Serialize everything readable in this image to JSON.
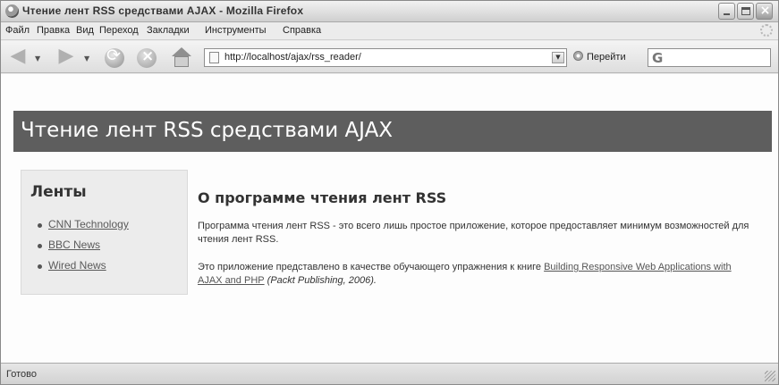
{
  "window": {
    "title": "Чтение лент RSS средствами AJAX - Mozilla Firefox"
  },
  "menu": {
    "items": [
      "Файл",
      "Правка",
      "Вид",
      "Переход",
      "Закладки",
      "Инструменты",
      "Справка"
    ]
  },
  "toolbar": {
    "url": "http://localhost/ajax/rss_reader/",
    "go_label": "Перейти",
    "search_engine_glyph": "G"
  },
  "page": {
    "header_title": "Чтение лент RSS средствами AJAX",
    "sidebar": {
      "heading": "Ленты",
      "feeds": [
        "CNN Technology",
        "BBC News",
        "Wired News"
      ]
    },
    "main": {
      "heading": "О программе чтения лент RSS",
      "paragraph1": "Программа чтения лент RSS - это всего лишь простое приложение, которое предоставляет минимум возможностей для чтения лент RSS.",
      "paragraph2_prefix": "Это приложение представлено в качестве обучающего упражнения к книге ",
      "book_link": "Building Responsive Web Applications with AJAX and PHP",
      "paragraph2_suffix": " (Packt Publishing, 2006)."
    }
  },
  "status": {
    "text": "Готово"
  }
}
